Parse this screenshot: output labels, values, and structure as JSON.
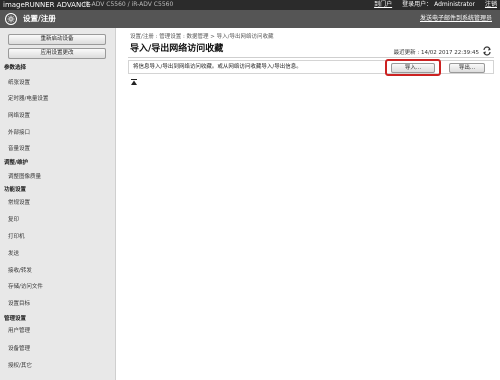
{
  "header": {
    "brand": "imageRUNNER ADVANCE",
    "device": "iR-ADV C5560 / iR-ADV C5560",
    "portal_link": "到门户",
    "login_label": "登录用户：",
    "user": "Administrator",
    "logout_link": "注销"
  },
  "subheader": {
    "title": "设置/注册",
    "mail_link": "发送电子邮件到系统管理员",
    "icon": "gear-icon"
  },
  "sidebar": {
    "buttons": [
      "重新启动设备",
      "应用设置更改"
    ],
    "heading_prefs": "参数选择",
    "prefs_items": [
      "纸张设置",
      "定时器/电量设置",
      "网络设置",
      "外部接口",
      "音量设置"
    ],
    "heading_adjust": "调整/维护",
    "adjust_items": [
      "调整图像质量"
    ],
    "heading_func": "功能设置",
    "func_items": [
      "常规设置",
      "复印",
      "打印机",
      "发送",
      "接收/转发",
      "存储/访问文件"
    ],
    "misc_items": [
      "设置目标"
    ],
    "heading_mgmt": "管理设置",
    "mgmt_items": [
      "用户管理",
      "设备管理",
      "授权/其它"
    ]
  },
  "main": {
    "breadcrumb": "设置/注册 : 管理设置 : 数据管理 > 导入/导出网络访问收藏",
    "title": "导入/导出网络访问收藏",
    "last_updated": "最近更新 : 14/02 2017 22:39:45",
    "refresh_icon": "refresh-icon",
    "description": "将信息导入/导出到网络访问收藏。或从网络访问收藏导入/导出信息。",
    "import_label": "导入...",
    "export_label": "导出...",
    "top_icon": "arrow-top-icon",
    "highlight_color": "#cc2222"
  }
}
